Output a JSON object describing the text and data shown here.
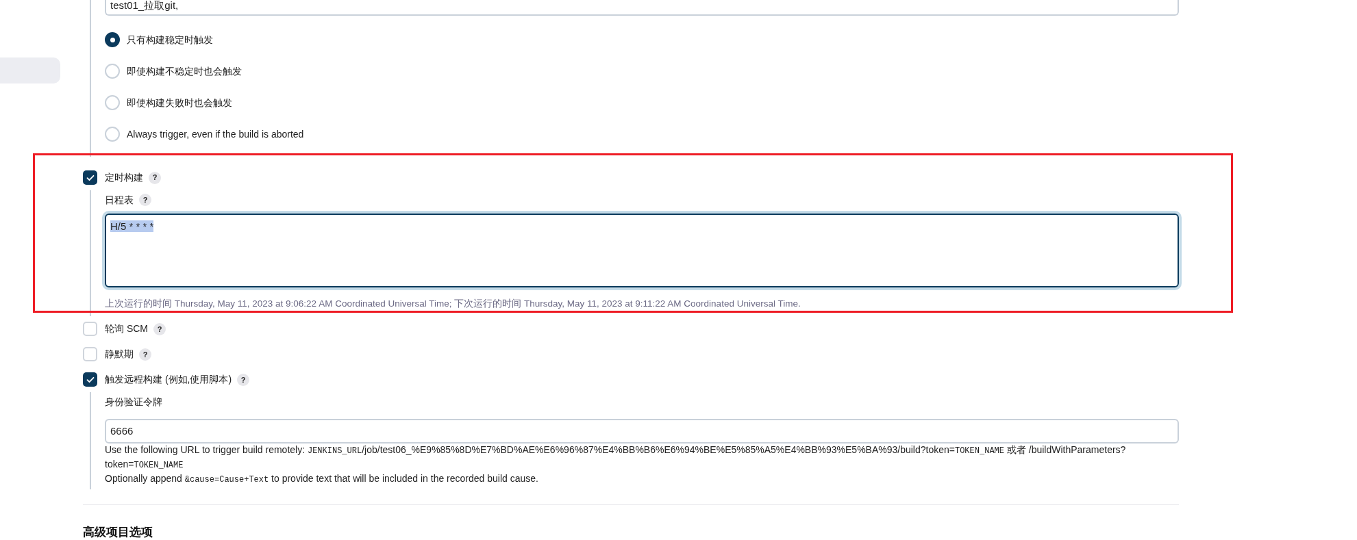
{
  "projects_field": {
    "value": "test01_拉取git,"
  },
  "trigger_conditions": [
    {
      "label": "只有构建稳定时触发",
      "selected": true
    },
    {
      "label": "即使构建不稳定时也会触发",
      "selected": false
    },
    {
      "label": "即使构建失败时也会触发",
      "selected": false
    },
    {
      "label": "Always trigger, even if the build is aborted",
      "selected": false
    }
  ],
  "build_triggers": [
    {
      "label": "定时构建",
      "checked": true,
      "highlighted": true,
      "kind": "schedule",
      "field_label": "日程表",
      "value": "H/5 * * * *",
      "value_selected": true,
      "hint": "上次运行的时间 Thursday, May 11, 2023 at 9:06:22 AM Coordinated Universal Time; 下次运行的时间 Thursday, May 11, 2023 at 9:11:22 AM Coordinated Universal Time."
    },
    {
      "label": "轮询 SCM",
      "checked": false
    },
    {
      "label": "静默期",
      "checked": false
    },
    {
      "label": "触发远程构建 (例如,使用脚本)",
      "checked": true,
      "kind": "token",
      "field_label": "身份验证令牌",
      "value": "6666",
      "help": [
        [
          {
            "kind": "text",
            "text": "Use the following URL to trigger build remotely: "
          },
          {
            "kind": "code",
            "text": "JENKINS_URL"
          },
          {
            "kind": "text",
            "text": "/job/test06_%E9%85%8D%E7%BD%AE%E6%96%87%E4%BB%B6%E6%94%BE%E5%85%A5%E4%BB%93%E5%BA%93/build?token="
          },
          {
            "kind": "code",
            "text": "TOKEN_NAME"
          },
          {
            "kind": "text",
            "text": " 或者 /buildWithParameters?token="
          },
          {
            "kind": "code",
            "text": "TOKEN_NAME"
          }
        ],
        [
          {
            "kind": "text",
            "text": "Optionally append "
          },
          {
            "kind": "code",
            "text": "&cause=Cause+Text"
          },
          {
            "kind": "text",
            "text": " to provide text that will be included in the recorded build cause."
          }
        ]
      ]
    }
  ],
  "help_mark": "?",
  "section_heading": "高级项目选项"
}
